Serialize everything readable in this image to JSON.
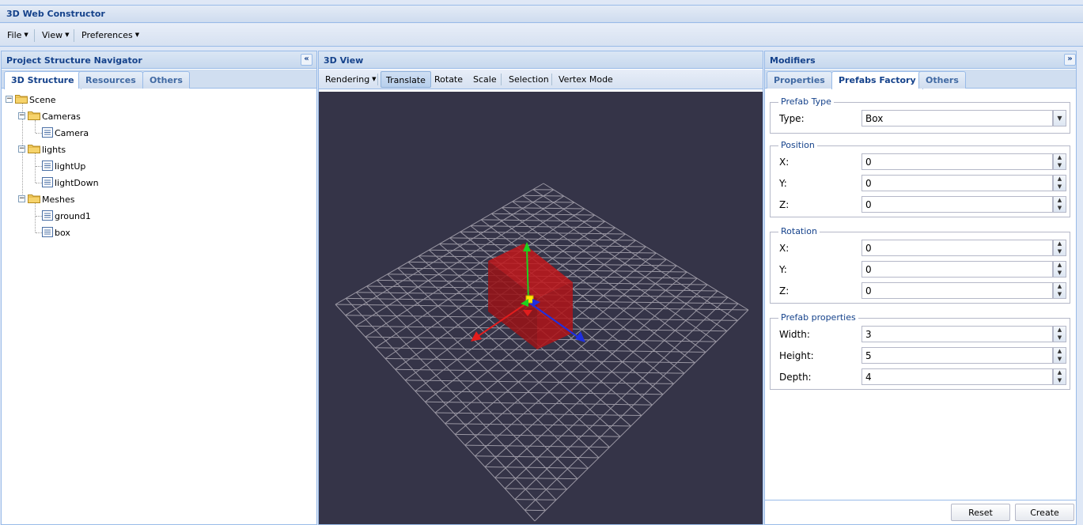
{
  "app": {
    "title": "3D Web Constructor"
  },
  "menu": [
    {
      "label": "File"
    },
    {
      "label": "View"
    },
    {
      "label": "Preferences"
    }
  ],
  "left_panel": {
    "title": "Project Structure Navigator",
    "tabs": [
      "3D Structure",
      "Resources",
      "Others"
    ],
    "active_tab": "3D Structure",
    "tree": [
      {
        "label": "Scene",
        "type": "folder",
        "expanded": true
      },
      {
        "label": "Cameras",
        "type": "folder",
        "expanded": true
      },
      {
        "label": "Camera",
        "type": "leaf"
      },
      {
        "label": "lights",
        "type": "folder",
        "expanded": true
      },
      {
        "label": "lightUp",
        "type": "leaf"
      },
      {
        "label": "lightDown",
        "type": "leaf"
      },
      {
        "label": "Meshes",
        "type": "folder",
        "expanded": true
      },
      {
        "label": "ground1",
        "type": "leaf"
      },
      {
        "label": "box",
        "type": "leaf"
      }
    ]
  },
  "center_panel": {
    "title": "3D View",
    "toolbar": [
      "Rendering",
      "Translate",
      "Rotate",
      "Scale",
      "Selection",
      "Vertex Mode"
    ],
    "pressed": "Translate",
    "viewport_bg": "#353448"
  },
  "right_panel": {
    "title": "Modifiers",
    "tabs": [
      "Properties",
      "Prefabs Factory",
      "Others"
    ],
    "active_tab": "Prefabs Factory",
    "prefab_type": {
      "legend": "Prefab Type",
      "label": "Type:",
      "value": "Box"
    },
    "position": {
      "legend": "Position",
      "x_label": "X:",
      "x": "0",
      "y_label": "Y:",
      "y": "0",
      "z_label": "Z:",
      "z": "0"
    },
    "rotation": {
      "legend": "Rotation",
      "x_label": "X:",
      "x": "0",
      "y_label": "Y:",
      "y": "0",
      "z_label": "Z:",
      "z": "0"
    },
    "prefab_properties": {
      "legend": "Prefab properties",
      "width_label": "Width:",
      "width": "3",
      "height_label": "Height:",
      "height": "5",
      "depth_label": "Depth:",
      "depth": "4"
    },
    "buttons": {
      "reset": "Reset",
      "create": "Create"
    }
  },
  "colors": {
    "header_text": "#15428b",
    "border": "#99bbe8",
    "box": "#b01418",
    "axis_x": "#e11d1d",
    "axis_y": "#1ed21e",
    "axis_z": "#1f2fe0"
  }
}
